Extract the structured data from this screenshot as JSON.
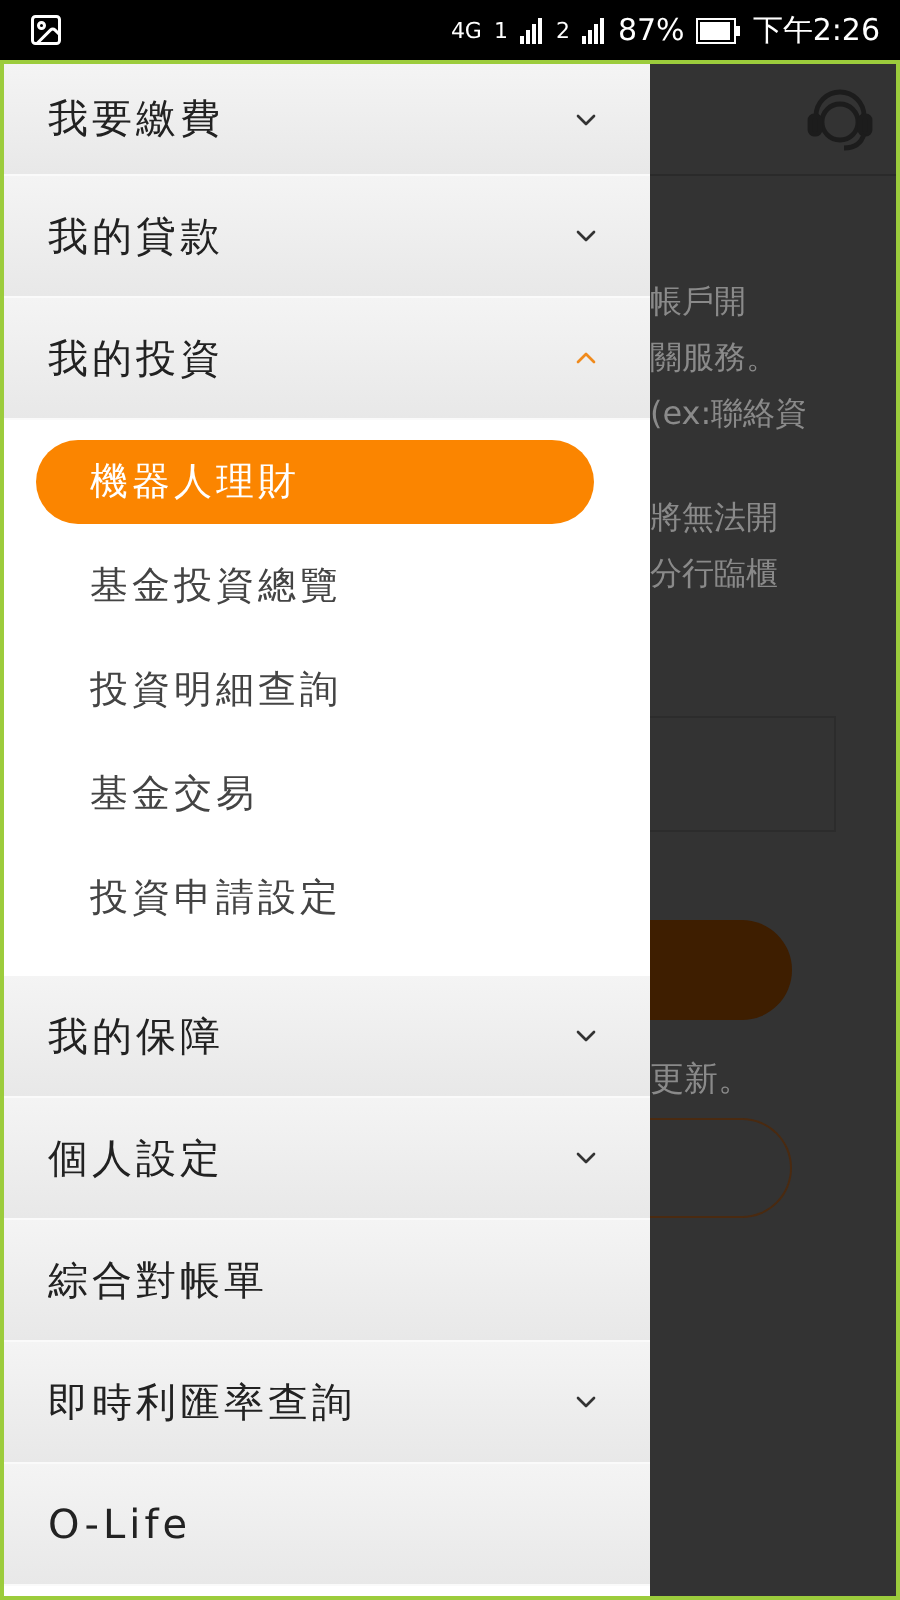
{
  "status_bar": {
    "network": "4G",
    "sim_1": "1",
    "sim_2": "2",
    "battery": "87%",
    "time": "下午2:26"
  },
  "background_page": {
    "lines": [
      "帳戶開",
      "關服務。",
      "(ex:聯絡資",
      "將無法開",
      "分行臨櫃"
    ],
    "note": "更新。"
  },
  "menu": [
    {
      "kind": "group",
      "label": "我要繳費",
      "expanded": false
    },
    {
      "kind": "group",
      "label": "我的貸款",
      "expanded": false
    },
    {
      "kind": "group",
      "label": "我的投資",
      "expanded": true,
      "children": [
        {
          "label": "機器人理財",
          "selected": true
        },
        {
          "label": "基金投資總覽",
          "selected": false
        },
        {
          "label": "投資明細查詢",
          "selected": false
        },
        {
          "label": "基金交易",
          "selected": false
        },
        {
          "label": "投資申請設定",
          "selected": false
        }
      ]
    },
    {
      "kind": "group",
      "label": "我的保障",
      "expanded": false
    },
    {
      "kind": "group",
      "label": "個人設定",
      "expanded": false
    },
    {
      "kind": "link",
      "label": "綜合對帳單"
    },
    {
      "kind": "group",
      "label": "即時利匯率查詢",
      "expanded": false
    },
    {
      "kind": "link",
      "label": "O-Life"
    }
  ]
}
